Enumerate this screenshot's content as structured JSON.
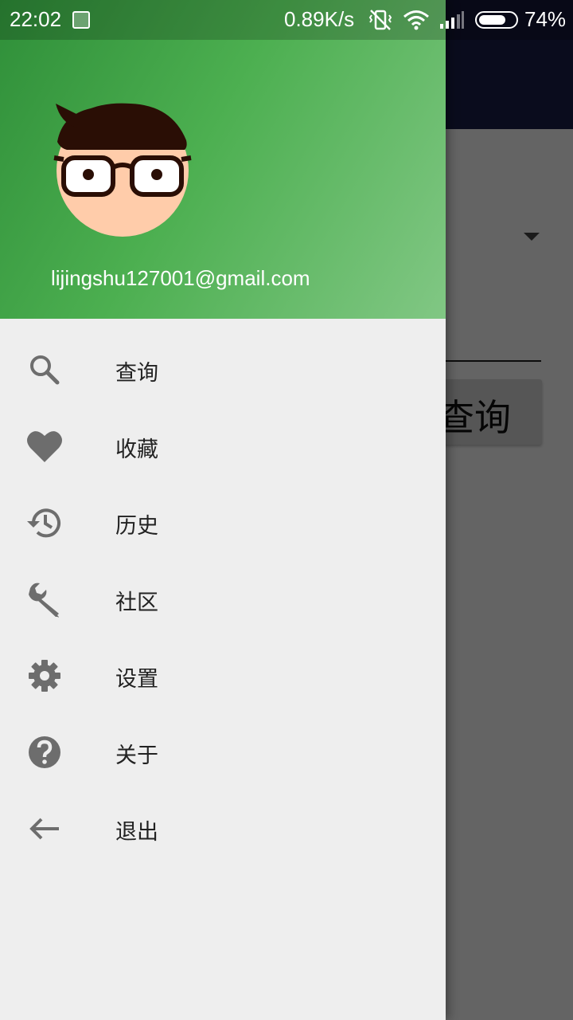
{
  "status_bar": {
    "time": "22:02",
    "network_speed": "0.89K/s",
    "battery_percent": "74%"
  },
  "background_app": {
    "query_button_label": "查询"
  },
  "drawer": {
    "account_email": "lijingshu127001@gmail.com",
    "menu_items": [
      {
        "label": "查询",
        "icon": "search-icon"
      },
      {
        "label": "收藏",
        "icon": "heart-icon"
      },
      {
        "label": "历史",
        "icon": "history-icon"
      },
      {
        "label": "社区",
        "icon": "wrench-icon"
      },
      {
        "label": "设置",
        "icon": "gear-icon"
      },
      {
        "label": "关于",
        "icon": "help-icon"
      },
      {
        "label": "退出",
        "icon": "arrow-back-icon"
      }
    ]
  },
  "colors": {
    "header_green": "#4caf50",
    "toolbar_navy": "#1a1f4a",
    "drawer_bg": "#eeeeee",
    "icon_gray": "#6d6d6d"
  }
}
